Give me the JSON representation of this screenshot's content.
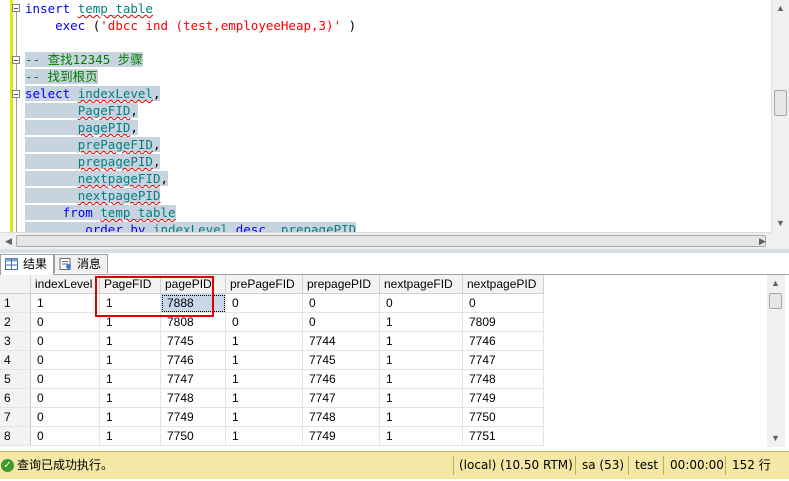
{
  "editor": {
    "lines": [
      {
        "parts": [
          [
            "kw",
            "insert "
          ],
          [
            "obj",
            "temp_table"
          ]
        ]
      },
      {
        "parts": [
          [
            "",
            "    "
          ],
          [
            "kw",
            "exec "
          ],
          [
            "",
            "("
          ],
          [
            "str",
            "'dbcc ind (test,employeeHeap,3)'"
          ],
          [
            "",
            " )"
          ]
        ]
      },
      {
        "parts": [
          [
            "",
            ""
          ]
        ]
      },
      {
        "parts": [
          [
            "cm",
            "-- "
          ],
          [
            "cmcjk",
            "查找"
          ],
          [
            "cm",
            "12345 "
          ],
          [
            "cmcjk",
            "步骤"
          ]
        ]
      },
      {
        "parts": [
          [
            "cm",
            "-- "
          ],
          [
            "cmcjk",
            "找到根页"
          ]
        ]
      },
      {
        "parts": [
          [
            "kw",
            "select "
          ],
          [
            "obj",
            "indexLevel"
          ],
          [
            "",
            ","
          ]
        ]
      },
      {
        "parts": [
          [
            "",
            "       "
          ],
          [
            "obj",
            "PageFID"
          ],
          [
            "",
            ","
          ]
        ]
      },
      {
        "parts": [
          [
            "",
            "       "
          ],
          [
            "obj",
            "pagePID"
          ],
          [
            "",
            ","
          ]
        ]
      },
      {
        "parts": [
          [
            "",
            "       "
          ],
          [
            "obj",
            "prePageFID"
          ],
          [
            "",
            ","
          ]
        ]
      },
      {
        "parts": [
          [
            "",
            "       "
          ],
          [
            "obj",
            "prepagePID"
          ],
          [
            "",
            ","
          ]
        ]
      },
      {
        "parts": [
          [
            "",
            "       "
          ],
          [
            "obj",
            "nextpageFID"
          ],
          [
            "",
            ","
          ]
        ]
      },
      {
        "parts": [
          [
            "",
            "       "
          ],
          [
            "obj",
            "nextpagePID"
          ]
        ]
      },
      {
        "parts": [
          [
            "",
            "     "
          ],
          [
            "kw",
            "from "
          ],
          [
            "obj",
            "temp_table"
          ]
        ]
      },
      {
        "parts": [
          [
            "",
            "        "
          ],
          [
            "kw",
            "order by "
          ],
          [
            "obj",
            "indexLevel "
          ],
          [
            "kw",
            "desc"
          ],
          [
            "",
            ", "
          ],
          [
            "obj",
            "prepagePID"
          ]
        ]
      }
    ]
  },
  "tabs": {
    "results": "结果",
    "messages": "消息"
  },
  "grid": {
    "columns": [
      "indexLevel",
      "PageFID",
      "pagePID",
      "prePageFID",
      "prepagePID",
      "nextpageFID",
      "nextpagePID"
    ],
    "rows": [
      [
        "1",
        "1",
        "1",
        "7888",
        "0",
        "0",
        "0",
        "0"
      ],
      [
        "2",
        "0",
        "1",
        "7808",
        "0",
        "0",
        "1",
        "7809"
      ],
      [
        "3",
        "0",
        "1",
        "7745",
        "1",
        "7744",
        "1",
        "7746"
      ],
      [
        "4",
        "0",
        "1",
        "7746",
        "1",
        "7745",
        "1",
        "7747"
      ],
      [
        "5",
        "0",
        "1",
        "7747",
        "1",
        "7746",
        "1",
        "7748"
      ],
      [
        "6",
        "0",
        "1",
        "7748",
        "1",
        "7747",
        "1",
        "7749"
      ],
      [
        "7",
        "0",
        "1",
        "7749",
        "1",
        "7748",
        "1",
        "7750"
      ],
      [
        "8",
        "0",
        "1",
        "7750",
        "1",
        "7749",
        "1",
        "7751"
      ]
    ]
  },
  "status": {
    "message": "查询已成功执行。",
    "server": "(local) (10.50 RTM)",
    "user": "sa (53)",
    "database": "test",
    "elapsed": "00:00:00",
    "rows": "152 行"
  },
  "colors": {
    "status_bg": "#f3e8a5",
    "highlight_box": "#e00000",
    "selection": "#c8d3e0"
  }
}
